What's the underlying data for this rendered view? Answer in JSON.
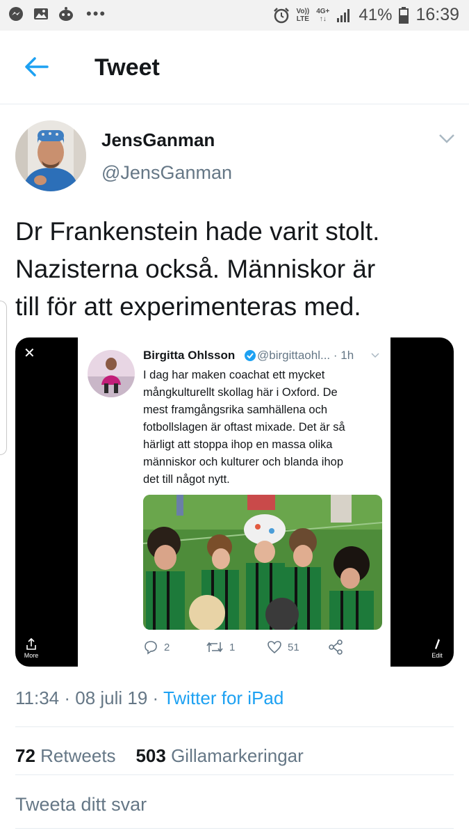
{
  "status_bar": {
    "signal_label_top": "Vo))",
    "signal_label_bottom": "LTE",
    "network_label": "4G+",
    "battery_percent": "41%",
    "time": "16:39"
  },
  "header": {
    "title": "Tweet"
  },
  "tweet": {
    "author_name": "JensGanman",
    "author_handle": "@JensGanman",
    "text_lines": [
      "Dr Frankenstein hade varit stolt.",
      "Nazisterna också. Människor är",
      "till för att experimenteras med."
    ],
    "timestamp": "11:34 · 08 juli 19 · ",
    "source": "Twitter for iPad",
    "retweets_count": "72",
    "retweets_label": "Retweets",
    "likes_count": "503",
    "likes_label": "Gillamarkeringar",
    "reply_placeholder": "Tweeta ditt svar"
  },
  "media": {
    "more_label": "More",
    "edit_label": "Edit",
    "embedded_tweet": {
      "name": "Birgitta Ohlsson",
      "handle_time": "@birgittaohl... · 1h",
      "text_lines": [
        "I dag har maken coachat ett mycket",
        "mångkulturellt skollag här i Oxford. De",
        "mest framgångsrika samhällena och",
        "fotbollslagen är oftast mixade.  Det är så",
        "härligt att stoppa ihop en massa olika",
        "människor och kulturer och blanda ihop",
        "det till något nytt."
      ],
      "replies": "2",
      "retweets": "1",
      "likes": "51"
    }
  },
  "colors": {
    "accent": "#1da1f2",
    "secondary_text": "#657786",
    "divider": "#e6ecf0"
  }
}
